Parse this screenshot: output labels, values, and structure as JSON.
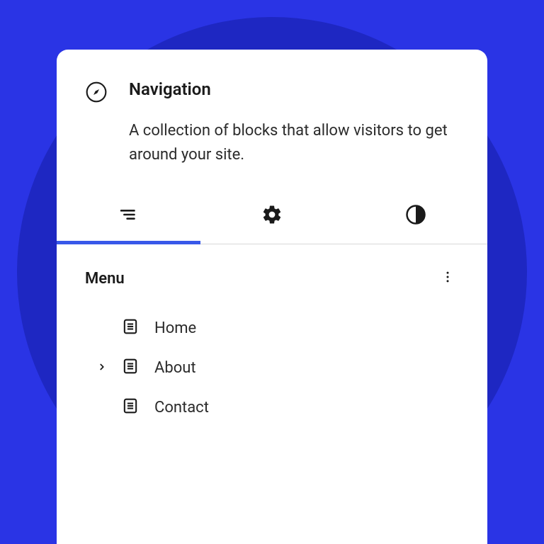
{
  "header": {
    "title": "Navigation",
    "description": "A collection of blocks that allow visitors to get around your site."
  },
  "tabs": {
    "items": [
      {
        "name": "list-view",
        "active": true
      },
      {
        "name": "settings",
        "active": false
      },
      {
        "name": "styles",
        "active": false
      }
    ]
  },
  "menu": {
    "title": "Menu",
    "items": [
      {
        "label": "Home",
        "has_children": false
      },
      {
        "label": "About",
        "has_children": true
      },
      {
        "label": "Contact",
        "has_children": false
      }
    ]
  }
}
